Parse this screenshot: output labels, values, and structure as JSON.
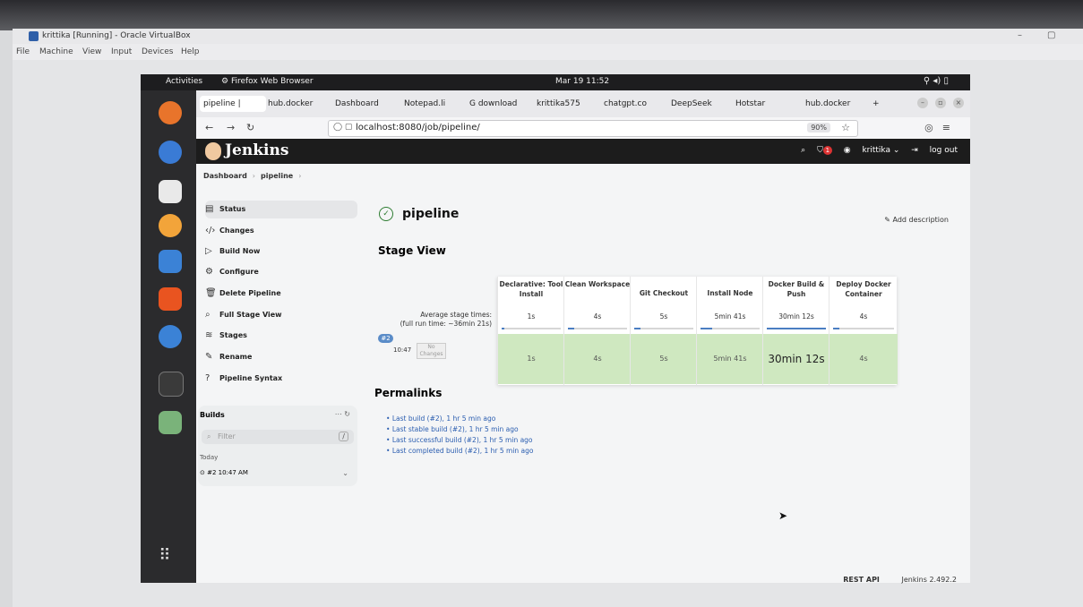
{
  "vbox": {
    "title": "krittika [Running] - Oracle VirtualBox",
    "menu": [
      "File",
      "Machine",
      "View",
      "Input",
      "Devices",
      "Help"
    ]
  },
  "gnome": {
    "activities": "Activities",
    "app": "Firefox Web Browser",
    "clock": "Mar 19  11:52"
  },
  "browser": {
    "tabs": [
      {
        "label": "pipeline |",
        "active": true
      },
      {
        "label": "hub.docker"
      },
      {
        "label": "Dashboard"
      },
      {
        "label": "Notepad.li"
      },
      {
        "label": "G download"
      },
      {
        "label": "krittika575"
      },
      {
        "label": "chatgpt.co"
      },
      {
        "label": "DeepSeek"
      },
      {
        "label": "Hotstar"
      },
      {
        "label": "hub.docker"
      }
    ],
    "url": "localhost:8080/job/pipeline/",
    "zoom": "90%"
  },
  "jenkins": {
    "brand": "Jenkins",
    "user": "krittika",
    "logout": "log out",
    "notification_count": "1",
    "breadcrumb": [
      "Dashboard",
      "pipeline"
    ],
    "sidebar": [
      {
        "label": "Status",
        "icon": "document-icon"
      },
      {
        "label": "Changes",
        "icon": "code-icon"
      },
      {
        "label": "Build Now",
        "icon": "play-icon"
      },
      {
        "label": "Configure",
        "icon": "gear-icon"
      },
      {
        "label": "Delete Pipeline",
        "icon": "trash-icon"
      },
      {
        "label": "Full Stage View",
        "icon": "search-icon"
      },
      {
        "label": "Stages",
        "icon": "stack-icon"
      },
      {
        "label": "Rename",
        "icon": "pencil-icon"
      },
      {
        "label": "Pipeline Syntax",
        "icon": "help-icon"
      }
    ],
    "builds": {
      "title": "Builds",
      "filter_placeholder": "Filter",
      "filter_key": "/",
      "group": "Today",
      "entry": "#2  10:47 AM"
    },
    "job_title": "pipeline",
    "add_description": "Add description",
    "stage_view_title": "Stage View",
    "avg_label_1": "Average stage times:",
    "avg_label_2": "(full run time: ~36min 21s)",
    "build_num": "#2",
    "build_time": "10:47",
    "no_changes": "No Changes",
    "stages": [
      {
        "name": "Declarative: Tool Install",
        "avg": "1s",
        "run": "1s",
        "bar": 0.05
      },
      {
        "name": "Clean Workspace",
        "avg": "4s",
        "run": "4s",
        "bar": 0.1
      },
      {
        "name": "Git Checkout",
        "avg": "5s",
        "run": "5s",
        "bar": 0.1
      },
      {
        "name": "Install Node",
        "avg": "5min 41s",
        "run": "5min 41s",
        "bar": 0.2
      },
      {
        "name": "Docker Build & Push",
        "avg": "30min 12s",
        "run": "30min 12s",
        "bar": 1.0
      },
      {
        "name": "Deploy Docker Container",
        "avg": "4s",
        "run": "4s",
        "bar": 0.1
      }
    ],
    "permalinks_title": "Permalinks",
    "permalinks": [
      "Last build (#2), 1 hr 5 min ago",
      "Last stable build (#2), 1 hr 5 min ago",
      "Last successful build (#2), 1 hr 5 min ago",
      "Last completed build (#2), 1 hr 5 min ago"
    ],
    "footer": {
      "rest": "REST API",
      "version": "Jenkins 2.492.2"
    }
  }
}
